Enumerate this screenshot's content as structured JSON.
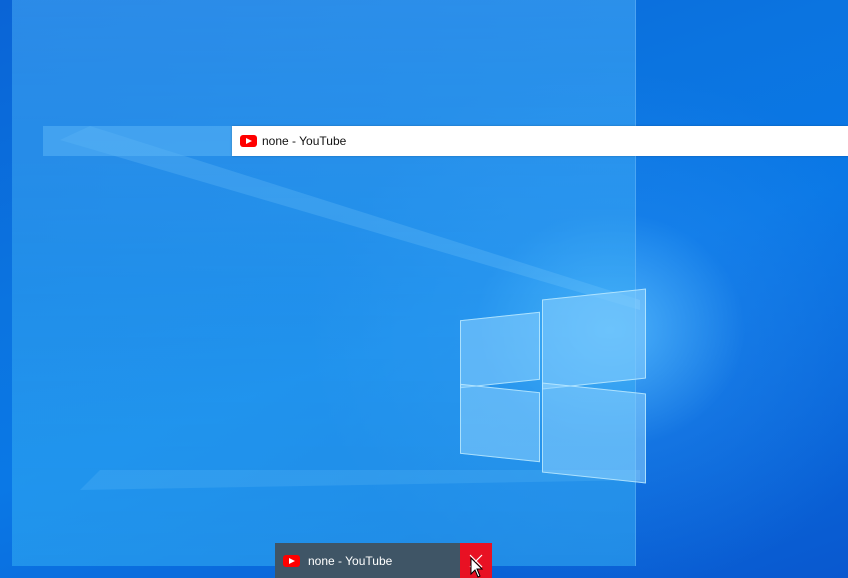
{
  "window_preview": {
    "title": "none - YouTube",
    "icon": "youtube-icon"
  },
  "taskbar_thumbnail": {
    "title": "none - YouTube",
    "icon": "youtube-icon",
    "close_icon": "close-icon",
    "close_color": "#e81123"
  },
  "colors": {
    "desktop": "#0a6fe0",
    "youtube_red": "#ff0000",
    "taskbar_thumb_bg": "#3f5566"
  }
}
